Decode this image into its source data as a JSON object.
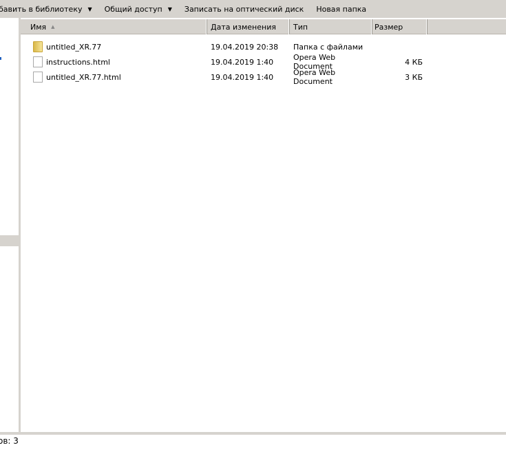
{
  "toolbar": {
    "add_library": "бавить в библиотеку",
    "share": "Общий доступ",
    "burn": "Записать на оптический диск",
    "new_folder": "Новая папка"
  },
  "columns": {
    "name": "Имя",
    "date": "Дата изменения",
    "type": "Тип",
    "size": "Размер"
  },
  "files": [
    {
      "name": "untitled_XR.77",
      "date": "19.04.2019 20:38",
      "type": "Папка с файлами",
      "size": "",
      "icon": "folder-icon"
    },
    {
      "name": "instructions.html",
      "date": "19.04.2019 1:40",
      "type": "Opera Web Document",
      "size": "4 КБ",
      "icon": "file-icon"
    },
    {
      "name": "untitled_XR.77.html",
      "date": "19.04.2019 1:40",
      "type": "Opera Web Document",
      "size": "3 КБ",
      "icon": "file-icon"
    }
  ],
  "status": "ов: 3",
  "colors": {
    "chrome": "#d6d3ce",
    "accent": "#1f5fbf"
  }
}
